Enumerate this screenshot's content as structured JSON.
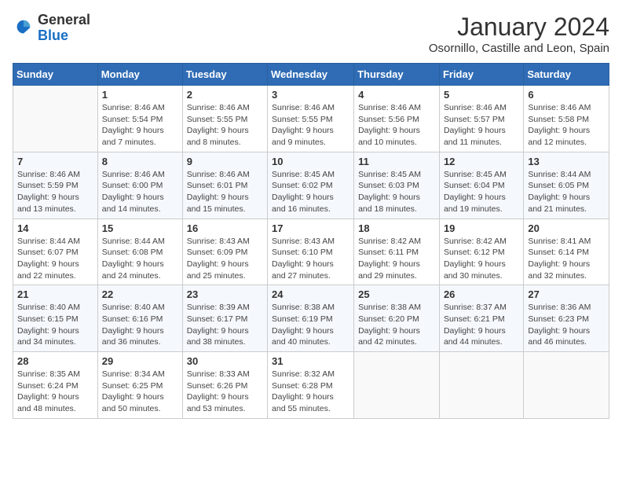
{
  "logo": {
    "general": "General",
    "blue": "Blue"
  },
  "title": "January 2024",
  "location": "Osornillo, Castille and Leon, Spain",
  "days_of_week": [
    "Sunday",
    "Monday",
    "Tuesday",
    "Wednesday",
    "Thursday",
    "Friday",
    "Saturday"
  ],
  "weeks": [
    [
      {
        "day": "",
        "info": ""
      },
      {
        "day": "1",
        "info": "Sunrise: 8:46 AM\nSunset: 5:54 PM\nDaylight: 9 hours\nand 7 minutes."
      },
      {
        "day": "2",
        "info": "Sunrise: 8:46 AM\nSunset: 5:55 PM\nDaylight: 9 hours\nand 8 minutes."
      },
      {
        "day": "3",
        "info": "Sunrise: 8:46 AM\nSunset: 5:55 PM\nDaylight: 9 hours\nand 9 minutes."
      },
      {
        "day": "4",
        "info": "Sunrise: 8:46 AM\nSunset: 5:56 PM\nDaylight: 9 hours\nand 10 minutes."
      },
      {
        "day": "5",
        "info": "Sunrise: 8:46 AM\nSunset: 5:57 PM\nDaylight: 9 hours\nand 11 minutes."
      },
      {
        "day": "6",
        "info": "Sunrise: 8:46 AM\nSunset: 5:58 PM\nDaylight: 9 hours\nand 12 minutes."
      }
    ],
    [
      {
        "day": "7",
        "info": "Sunrise: 8:46 AM\nSunset: 5:59 PM\nDaylight: 9 hours\nand 13 minutes."
      },
      {
        "day": "8",
        "info": "Sunrise: 8:46 AM\nSunset: 6:00 PM\nDaylight: 9 hours\nand 14 minutes."
      },
      {
        "day": "9",
        "info": "Sunrise: 8:46 AM\nSunset: 6:01 PM\nDaylight: 9 hours\nand 15 minutes."
      },
      {
        "day": "10",
        "info": "Sunrise: 8:45 AM\nSunset: 6:02 PM\nDaylight: 9 hours\nand 16 minutes."
      },
      {
        "day": "11",
        "info": "Sunrise: 8:45 AM\nSunset: 6:03 PM\nDaylight: 9 hours\nand 18 minutes."
      },
      {
        "day": "12",
        "info": "Sunrise: 8:45 AM\nSunset: 6:04 PM\nDaylight: 9 hours\nand 19 minutes."
      },
      {
        "day": "13",
        "info": "Sunrise: 8:44 AM\nSunset: 6:05 PM\nDaylight: 9 hours\nand 21 minutes."
      }
    ],
    [
      {
        "day": "14",
        "info": "Sunrise: 8:44 AM\nSunset: 6:07 PM\nDaylight: 9 hours\nand 22 minutes."
      },
      {
        "day": "15",
        "info": "Sunrise: 8:44 AM\nSunset: 6:08 PM\nDaylight: 9 hours\nand 24 minutes."
      },
      {
        "day": "16",
        "info": "Sunrise: 8:43 AM\nSunset: 6:09 PM\nDaylight: 9 hours\nand 25 minutes."
      },
      {
        "day": "17",
        "info": "Sunrise: 8:43 AM\nSunset: 6:10 PM\nDaylight: 9 hours\nand 27 minutes."
      },
      {
        "day": "18",
        "info": "Sunrise: 8:42 AM\nSunset: 6:11 PM\nDaylight: 9 hours\nand 29 minutes."
      },
      {
        "day": "19",
        "info": "Sunrise: 8:42 AM\nSunset: 6:12 PM\nDaylight: 9 hours\nand 30 minutes."
      },
      {
        "day": "20",
        "info": "Sunrise: 8:41 AM\nSunset: 6:14 PM\nDaylight: 9 hours\nand 32 minutes."
      }
    ],
    [
      {
        "day": "21",
        "info": "Sunrise: 8:40 AM\nSunset: 6:15 PM\nDaylight: 9 hours\nand 34 minutes."
      },
      {
        "day": "22",
        "info": "Sunrise: 8:40 AM\nSunset: 6:16 PM\nDaylight: 9 hours\nand 36 minutes."
      },
      {
        "day": "23",
        "info": "Sunrise: 8:39 AM\nSunset: 6:17 PM\nDaylight: 9 hours\nand 38 minutes."
      },
      {
        "day": "24",
        "info": "Sunrise: 8:38 AM\nSunset: 6:19 PM\nDaylight: 9 hours\nand 40 minutes."
      },
      {
        "day": "25",
        "info": "Sunrise: 8:38 AM\nSunset: 6:20 PM\nDaylight: 9 hours\nand 42 minutes."
      },
      {
        "day": "26",
        "info": "Sunrise: 8:37 AM\nSunset: 6:21 PM\nDaylight: 9 hours\nand 44 minutes."
      },
      {
        "day": "27",
        "info": "Sunrise: 8:36 AM\nSunset: 6:23 PM\nDaylight: 9 hours\nand 46 minutes."
      }
    ],
    [
      {
        "day": "28",
        "info": "Sunrise: 8:35 AM\nSunset: 6:24 PM\nDaylight: 9 hours\nand 48 minutes."
      },
      {
        "day": "29",
        "info": "Sunrise: 8:34 AM\nSunset: 6:25 PM\nDaylight: 9 hours\nand 50 minutes."
      },
      {
        "day": "30",
        "info": "Sunrise: 8:33 AM\nSunset: 6:26 PM\nDaylight: 9 hours\nand 53 minutes."
      },
      {
        "day": "31",
        "info": "Sunrise: 8:32 AM\nSunset: 6:28 PM\nDaylight: 9 hours\nand 55 minutes."
      },
      {
        "day": "",
        "info": ""
      },
      {
        "day": "",
        "info": ""
      },
      {
        "day": "",
        "info": ""
      }
    ]
  ]
}
